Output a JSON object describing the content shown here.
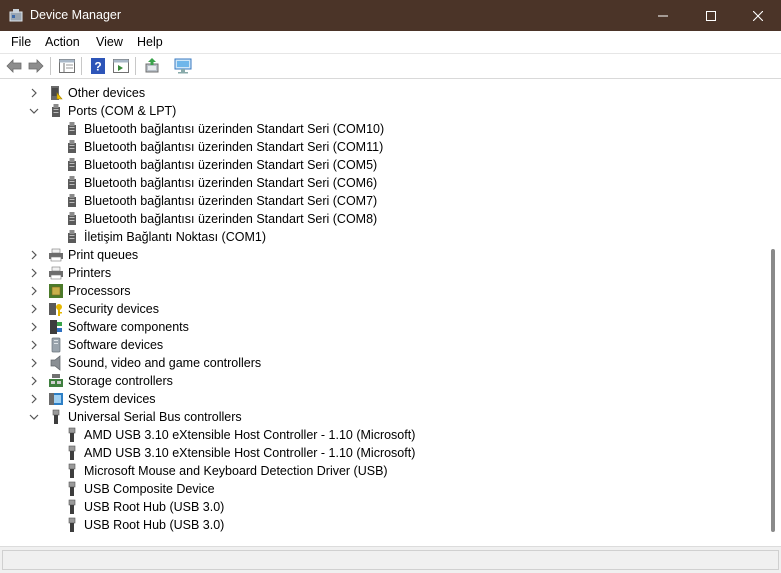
{
  "window": {
    "title": "Device Manager"
  },
  "menu": [
    "File",
    "Action",
    "View",
    "Help"
  ],
  "toolbar": {
    "icons": [
      "back-arrow-icon",
      "forward-arrow-icon",
      "show-hide-console-tree-icon",
      "help-icon",
      "properties-icon",
      "update-driver-icon",
      "scan-hardware-changes-icon"
    ]
  },
  "tree": {
    "categories_top": [
      {
        "label": "Other devices",
        "icon": "other-devices-icon",
        "expanded": false
      },
      {
        "label": "Ports (COM & LPT)",
        "icon": "port-icon",
        "expanded": true,
        "children": [
          "Bluetooth bağlantısı üzerinden Standart Seri (COM10)",
          "Bluetooth bağlantısı üzerinden Standart Seri (COM11)",
          "Bluetooth bağlantısı üzerinden Standart Seri (COM5)",
          "Bluetooth bağlantısı üzerinden Standart Seri (COM6)",
          "Bluetooth bağlantısı üzerinden Standart Seri (COM7)",
          "Bluetooth bağlantısı üzerinden Standart Seri (COM8)",
          "İletişim Bağlantı Noktası (COM1)"
        ]
      }
    ],
    "categories_mid": [
      {
        "label": "Print queues",
        "icon": "printer-icon"
      },
      {
        "label": "Printers",
        "icon": "printer-icon"
      },
      {
        "label": "Processors",
        "icon": "processor-icon"
      },
      {
        "label": "Security devices",
        "icon": "security-key-icon"
      },
      {
        "label": "Software components",
        "icon": "software-component-icon"
      },
      {
        "label": "Software devices",
        "icon": "software-device-icon"
      },
      {
        "label": "Sound, video and game controllers",
        "icon": "speaker-icon"
      },
      {
        "label": "Storage controllers",
        "icon": "storage-controller-icon"
      },
      {
        "label": "System devices",
        "icon": "system-device-icon"
      }
    ],
    "usb": {
      "label": "Universal Serial Bus controllers",
      "icon": "usb-icon",
      "expanded": true,
      "children": [
        "AMD USB 3.10 eXtensible Host Controller - 1.10 (Microsoft)",
        "AMD USB 3.10 eXtensible Host Controller - 1.10 (Microsoft)",
        "Microsoft Mouse and Keyboard Detection Driver (USB)",
        "USB Composite Device",
        "USB Root Hub (USB 3.0)",
        "USB Root Hub (USB 3.0)"
      ]
    }
  }
}
